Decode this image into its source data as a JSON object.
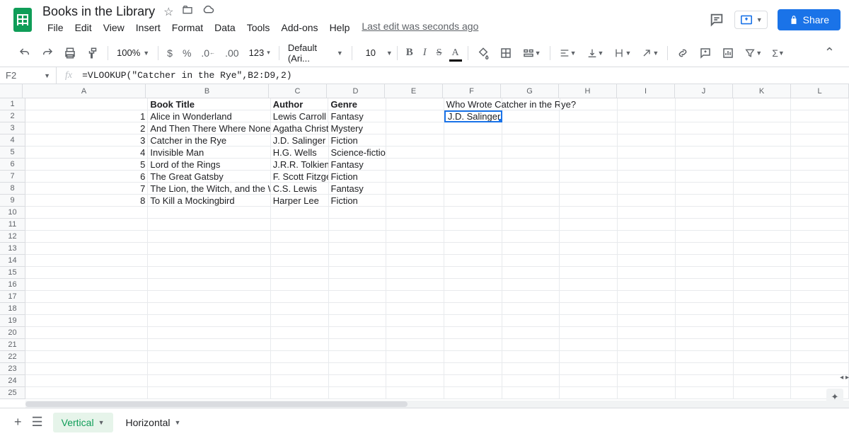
{
  "doc": {
    "title": "Books in the Library"
  },
  "menu": [
    "File",
    "Edit",
    "View",
    "Insert",
    "Format",
    "Data",
    "Tools",
    "Add-ons",
    "Help"
  ],
  "last_edit": "Last edit was seconds ago",
  "toolbar": {
    "zoom": "100%",
    "font": "Default (Ari...",
    "font_size": "10",
    "num_fmt": "123"
  },
  "name_box": "F2",
  "formula": "=VLOOKUP(\"Catcher in the Rye\",B2:D9,2)",
  "columns": [
    "A",
    "B",
    "C",
    "D",
    "E",
    "F",
    "G",
    "H",
    "I",
    "J",
    "K",
    "L"
  ],
  "row_count": 25,
  "headers": {
    "B": "Book Title",
    "C": "Author",
    "D": "Genre"
  },
  "books": [
    {
      "n": 1,
      "title": "Alice in Wonderland",
      "author": "Lewis Carroll",
      "genre": "Fantasy"
    },
    {
      "n": 2,
      "title": "And Then There Where None",
      "author": "Agatha Christie",
      "genre": "Mystery"
    },
    {
      "n": 3,
      "title": "Catcher in the Rye",
      "author": "J.D. Salinger",
      "genre": "Fiction"
    },
    {
      "n": 4,
      "title": "Invisible Man",
      "author": "H.G. Wells",
      "genre": "Science-fiction"
    },
    {
      "n": 5,
      "title": "Lord of the Rings",
      "author": "J.R.R. Tolkien",
      "genre": "Fantasy"
    },
    {
      "n": 6,
      "title": "The Great Gatsby",
      "author": "F. Scott Fitzgera",
      "genre": "Fiction"
    },
    {
      "n": 7,
      "title": "The Lion, the Witch, and the Wardr",
      "author": "C.S. Lewis",
      "genre": "Fantasy"
    },
    {
      "n": 8,
      "title": "To Kill a Mockingbird",
      "author": "Harper Lee",
      "genre": "Fiction"
    }
  ],
  "f1": "Who Wrote Catcher in the Rye?",
  "f2": "J.D. Salinger",
  "share": "Share",
  "tabs": [
    {
      "name": "Vertical",
      "active": true
    },
    {
      "name": "Horizontal",
      "active": false
    }
  ]
}
